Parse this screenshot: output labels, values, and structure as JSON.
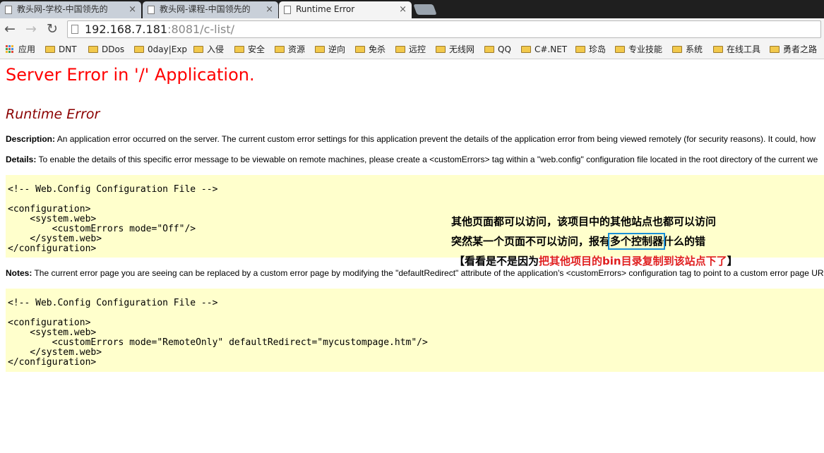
{
  "browser": {
    "tabs": [
      {
        "title": "教头网-学校-中国领先的"
      },
      {
        "title": "教头网-课程-中国领先的"
      },
      {
        "title": "Runtime Error",
        "active": true
      }
    ],
    "close_glyph": "×",
    "url": {
      "host": "192.168.7.181",
      "rest": ":8081/c-list/"
    },
    "bookmarks": [
      "应用",
      "DNT",
      "DDos",
      "0day|Exp",
      "入侵",
      "安全",
      "资源",
      "逆向",
      "免杀",
      "远控",
      "无线网",
      "QQ",
      "C#.NET",
      "珍岛",
      "专业技能",
      "系统",
      "在线工具",
      "勇者之路"
    ]
  },
  "page": {
    "title": "Server Error in '/' Application.",
    "subtitle": "Runtime Error",
    "description_label": "Description:",
    "description_text": " An application error occurred on the server. The current custom error settings for this application prevent the details of the application error from being viewed remotely (for security reasons). It could, how",
    "details_label": "Details:",
    "details_text": " To enable the details of this specific error message to be viewable on remote machines, please create a <customErrors> tag within a \"web.config\" configuration file located in the root directory of the current we",
    "code1": "<!-- Web.Config Configuration File -->\n\n<configuration>\n    <system.web>\n        <customErrors mode=\"Off\"/>\n    </system.web>\n</configuration>",
    "notes_label": "Notes:",
    "notes_text": " The current error page you are seeing can be replaced by a custom error page by modifying the \"defaultRedirect\" attribute of the application's <customErrors> configuration tag to point to a custom error page UR",
    "code2": "<!-- Web.Config Configuration File -->\n\n<configuration>\n    <system.web>\n        <customErrors mode=\"RemoteOnly\" defaultRedirect=\"mycustompage.htm\"/>\n    </system.web>\n</configuration>"
  },
  "annotation": {
    "line1": "其他页面都可以访问，该项目中的其他站点也都可以访问",
    "line2_before": "突然某一个页面不可以访问，报有",
    "line2_boxed": "多个控制器",
    "line2_after": "什么的错",
    "line3_open": "【看看是不是因为",
    "line3_red": "把其他项目的bin目录复制到该站点下了",
    "line3_close": "】",
    "box_color": "#1a8fd6",
    "highlight_color": "#e02020"
  }
}
